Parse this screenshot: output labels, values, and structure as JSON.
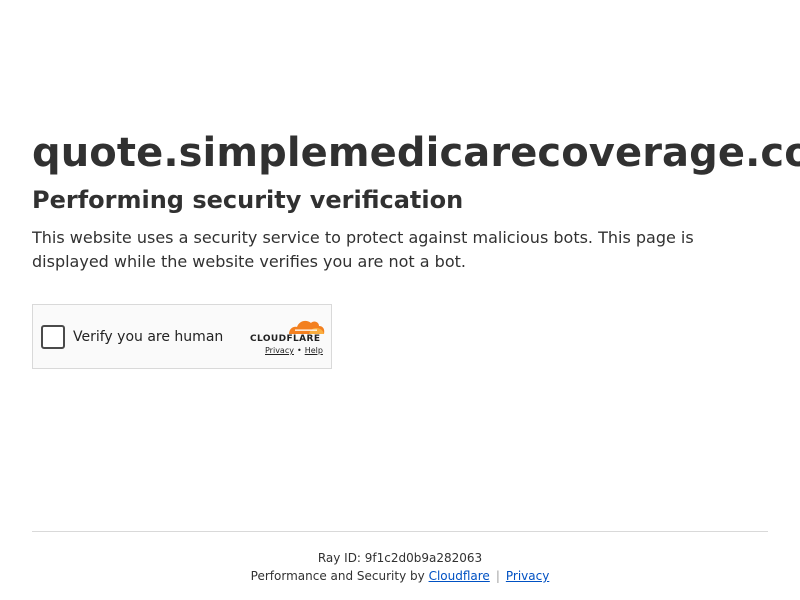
{
  "main": {
    "domain": "quote.simplemedicarecoverage.com",
    "heading": "Performing security verification",
    "description": "This website uses a security service to protect against malicious bots. This page is displayed while the website verifies you are not a bot."
  },
  "widget": {
    "checkbox_label": "Verify you are human",
    "brand": "CLOUDFLARE",
    "privacy_link": "Privacy",
    "separator": "•",
    "help_link": "Help",
    "brand_color": "#f38020",
    "checked": false
  },
  "footer": {
    "ray_id": "Ray ID: 9f1c2d0b9a282063",
    "perf_text": "Performance and Security by",
    "cloudflare_link": "Cloudflare",
    "divider": "|",
    "privacy_link": "Privacy",
    "link_color": "#0051c3"
  }
}
